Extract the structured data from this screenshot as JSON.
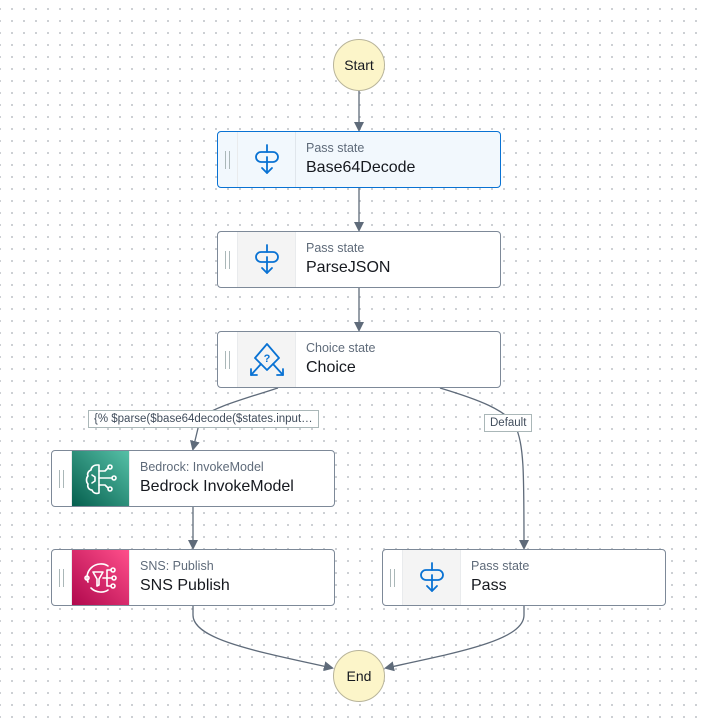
{
  "diagram": {
    "start": {
      "label": "Start"
    },
    "end": {
      "label": "End"
    },
    "states": [
      {
        "id": "base64decode",
        "type": "Pass state",
        "name": "Base64Decode",
        "icon": "pass-state-icon",
        "selected": true
      },
      {
        "id": "parsejson",
        "type": "Pass state",
        "name": "ParseJSON",
        "icon": "pass-state-icon",
        "selected": false
      },
      {
        "id": "choice",
        "type": "Choice state",
        "name": "Choice",
        "icon": "choice-state-icon",
        "selected": false
      },
      {
        "id": "bedrock",
        "type": "Bedrock: InvokeModel",
        "name": "Bedrock InvokeModel",
        "icon": "bedrock-icon",
        "selected": false
      },
      {
        "id": "sns",
        "type": "SNS: Publish",
        "name": "SNS Publish",
        "icon": "sns-icon",
        "selected": false
      },
      {
        "id": "pass",
        "type": "Pass state",
        "name": "Pass",
        "icon": "pass-state-icon",
        "selected": false
      }
    ],
    "edge_labels": {
      "condition": "{% $parse($base64decode($states.input…",
      "default": "Default"
    },
    "colors": {
      "selected_border": "#0972d3",
      "circle_fill": "#fcf5c9",
      "icon_blue": "#0972d3",
      "bedrock": "#1b8a72",
      "sns": "#e7157b",
      "edge": "#5f6b7a"
    }
  }
}
